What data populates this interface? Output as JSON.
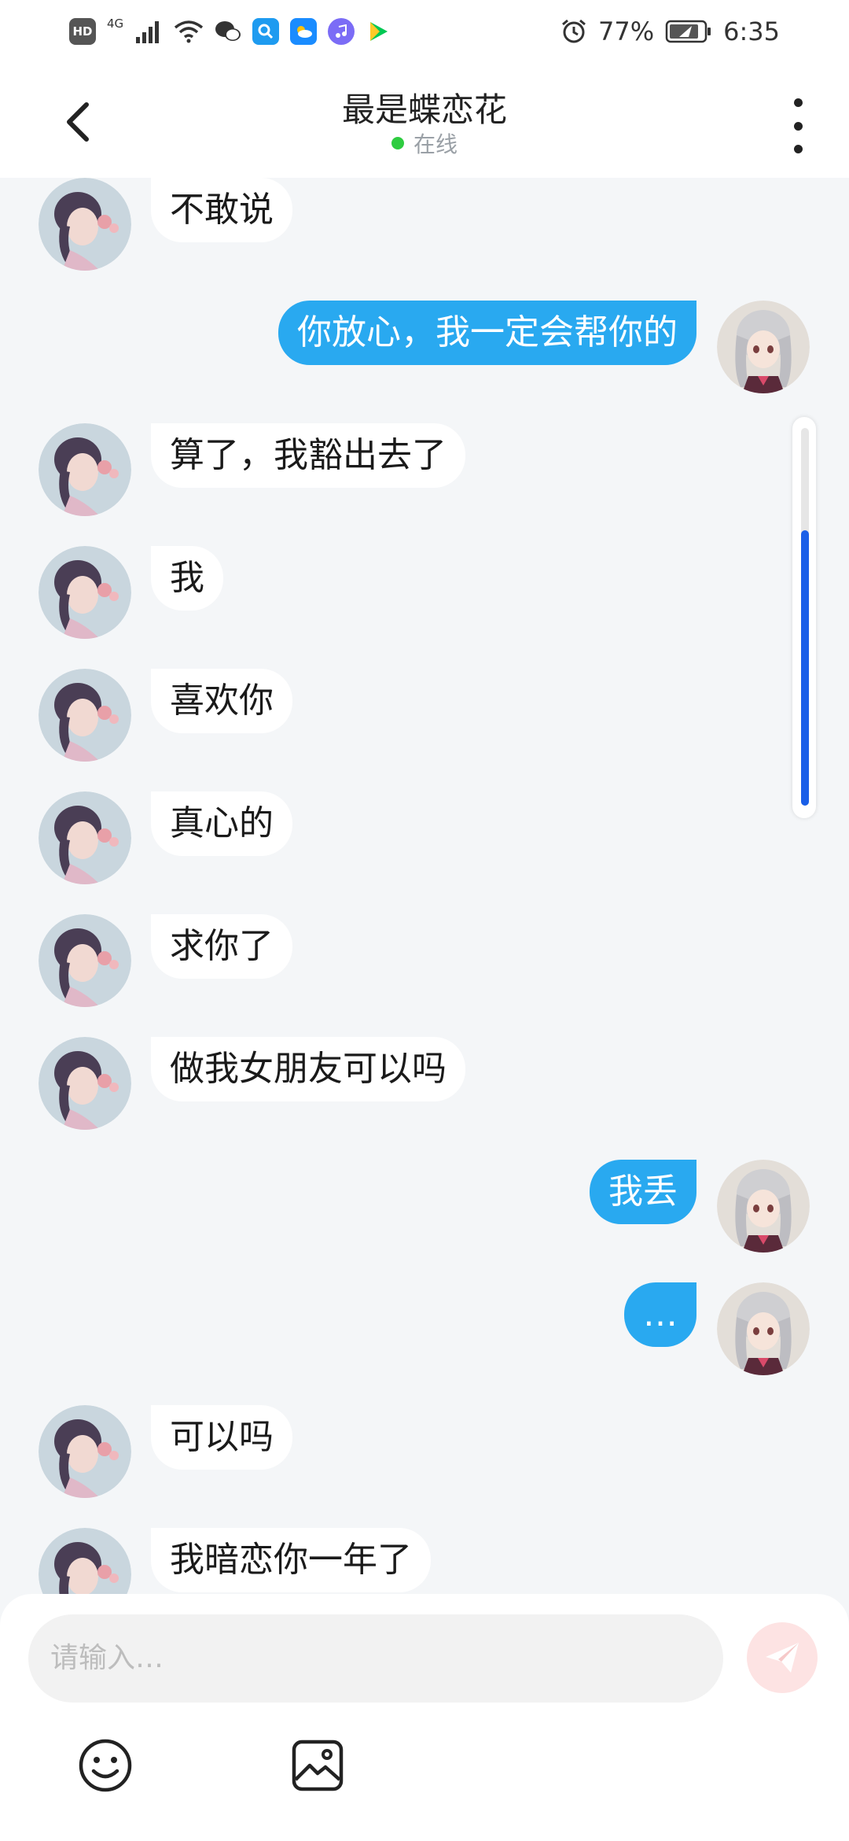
{
  "status_bar": {
    "network_hd": "HD",
    "network_type": "4G",
    "battery_percent": "77%",
    "time": "6:35",
    "icons": [
      "signal-icon",
      "wifi-icon",
      "wechat-icon",
      "search-app-icon",
      "weather-app-icon",
      "music-app-icon",
      "play-app-icon",
      "alarm-icon",
      "battery-icon"
    ]
  },
  "header": {
    "title": "最是蝶恋花",
    "status_text": "在线",
    "status_color": "#2ecc40"
  },
  "messages": [
    {
      "side": "in",
      "text": "不敢说"
    },
    {
      "side": "out",
      "text": "你放心，我一定会帮你的"
    },
    {
      "side": "in",
      "text": "算了，我豁出去了"
    },
    {
      "side": "in",
      "text": "我"
    },
    {
      "side": "in",
      "text": "喜欢你"
    },
    {
      "side": "in",
      "text": "真心的"
    },
    {
      "side": "in",
      "text": "求你了"
    },
    {
      "side": "in",
      "text": "做我女朋友可以吗"
    },
    {
      "side": "out",
      "text": "我丢"
    },
    {
      "side": "out",
      "text": "…"
    },
    {
      "side": "in",
      "text": "可以吗"
    },
    {
      "side": "in",
      "text": "我暗恋你一年了"
    }
  ],
  "scroll": {
    "thumb_start": 0.27,
    "thumb_end": 1.0
  },
  "composer": {
    "placeholder": "请输入…",
    "send_color": "#fde3e3"
  },
  "colors": {
    "outgoing_bubble": "#29a9f0",
    "incoming_bubble": "#ffffff",
    "background": "#f4f6f8"
  }
}
